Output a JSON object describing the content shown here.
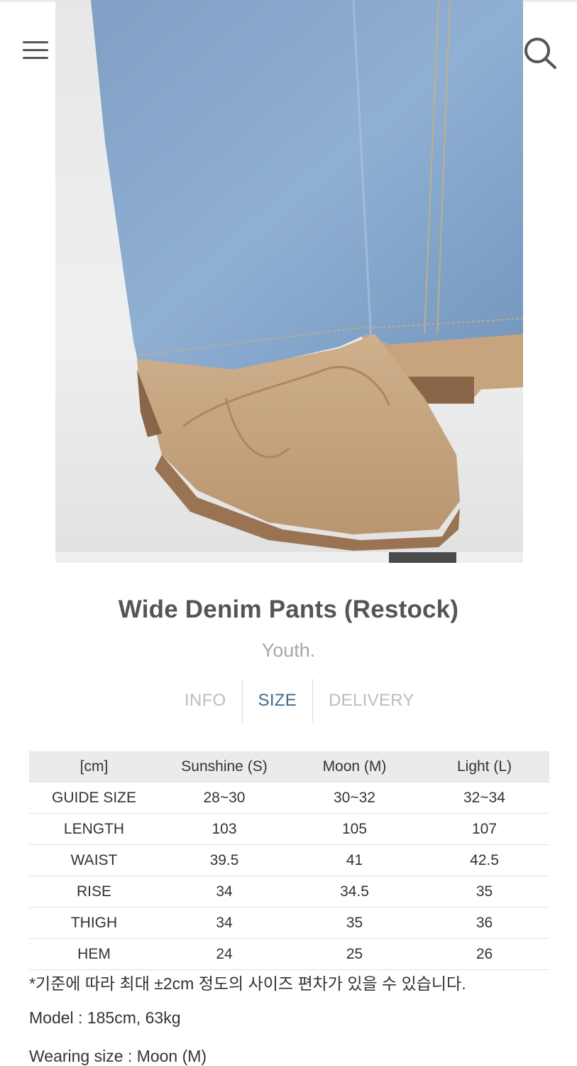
{
  "header": {
    "menu_icon": "hamburger-menu-icon",
    "search_icon": "search-icon"
  },
  "gallery": {
    "image_subject": "product-photo-denim-and-suede-boot",
    "current_slide": 6,
    "total_slides": 7
  },
  "product": {
    "title": "Wide Denim Pants (Restock)",
    "brand": "Youth."
  },
  "tabs": [
    {
      "label": "INFO",
      "active": false
    },
    {
      "label": "SIZE",
      "active": true
    },
    {
      "label": "DELIVERY",
      "active": false
    }
  ],
  "size_table": {
    "headers": [
      "[cm]",
      "Sunshine (S)",
      "Moon (M)",
      "Light (L)"
    ],
    "rows": [
      [
        "GUIDE SIZE",
        "28~30",
        "30~32",
        "32~34"
      ],
      [
        "LENGTH",
        "103",
        "105",
        "107"
      ],
      [
        "WAIST",
        "39.5",
        "41",
        "42.5"
      ],
      [
        "RISE",
        "34",
        "34.5",
        "35"
      ],
      [
        "THIGH",
        "34",
        "35",
        "36"
      ],
      [
        "HEM",
        "24",
        "25",
        "26"
      ]
    ]
  },
  "notes": {
    "tolerance": "*기준에 따라 최대 ±2cm 정도의 사이즈 편차가 있을 수 있습니다.",
    "model": "Model : 185cm, 63kg",
    "wearing": "Wearing size : Moon (M)"
  },
  "colors": {
    "active_tab": "#3f6e8a",
    "inactive_tab": "#bdbdbd",
    "table_header_bg": "#ebebeb"
  }
}
